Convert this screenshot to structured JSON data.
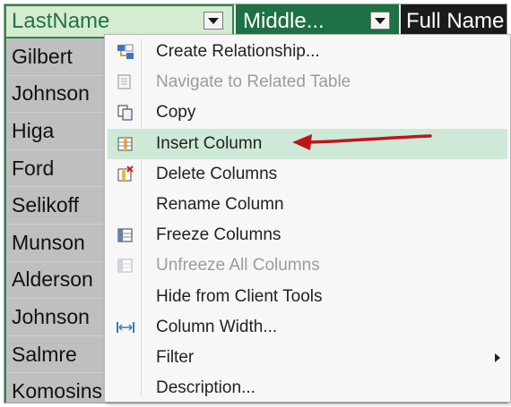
{
  "headers": {
    "last": "LastName",
    "middle": "Middle...",
    "full": "Full Name"
  },
  "rows": [
    "Gilbert",
    "Johnson",
    "Higa",
    "Ford",
    "Selikoff",
    "Munson",
    "Alderson",
    "Johnson",
    "Salmre",
    "Komosins..."
  ],
  "menu": {
    "items": [
      {
        "label": "Create Relationship...",
        "icon": "create-relationship-icon"
      },
      {
        "label": "Navigate to Related Table",
        "icon": "navigate-table-icon",
        "disabled": true
      },
      {
        "label": "Copy",
        "icon": "copy-icon"
      },
      {
        "label": "Insert Column",
        "icon": "insert-column-icon",
        "highlighted": true
      },
      {
        "label": "Delete Columns",
        "icon": "delete-columns-icon"
      },
      {
        "label": "Rename Column",
        "icon": ""
      },
      {
        "label": "Freeze Columns",
        "icon": "freeze-columns-icon"
      },
      {
        "label": "Unfreeze All Columns",
        "icon": "unfreeze-columns-icon",
        "disabled": true
      },
      {
        "label": "Hide from Client Tools",
        "icon": ""
      },
      {
        "label": "Column Width...",
        "icon": "column-width-icon"
      },
      {
        "label": "Filter",
        "icon": "",
        "submenu": true
      },
      {
        "label": "Description...",
        "icon": ""
      }
    ]
  },
  "colors": {
    "header_selected_bg": "#d5ecd1",
    "header_green": "#1e7145",
    "highlight": "#cfe9d8",
    "annotation_arrow": "#c0141a"
  }
}
